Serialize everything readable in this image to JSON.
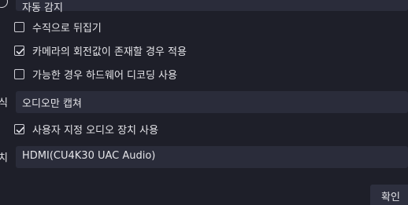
{
  "top": {
    "field_text": "자동 감지"
  },
  "checkboxes": [
    {
      "label": "수직으로 뒤집기",
      "checked": false
    },
    {
      "label": "카메라의 회전값이 존재할 경우 적용",
      "checked": true
    },
    {
      "label": "가능한 경우 하드웨어 디코딩 사용",
      "checked": false
    }
  ],
  "audio_output": {
    "label_fragment": "식",
    "value": "오디오만 캡쳐"
  },
  "custom_audio": {
    "label": "사용자 지정 오디오 장치 사용",
    "checked": true
  },
  "audio_device": {
    "label_fragment": "치",
    "value": "HDMI(CU4K30 UAC Audio)"
  },
  "ok_button": {
    "label": "확인"
  }
}
